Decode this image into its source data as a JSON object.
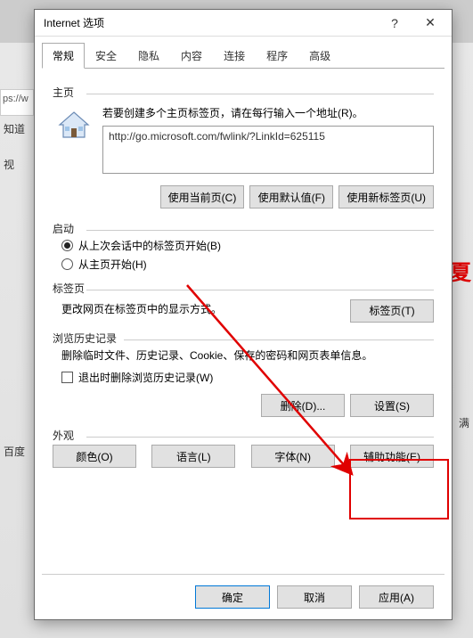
{
  "dialog": {
    "title": "Internet 选项",
    "help": "?",
    "close": "✕"
  },
  "tabs": [
    "常规",
    "安全",
    "隐私",
    "内容",
    "连接",
    "程序",
    "高级"
  ],
  "active_tab": 0,
  "homepage": {
    "group": "主页",
    "desc": "若要创建多个主页标签页，请在每行输入一个地址(R)。",
    "url": "http://go.microsoft.com/fwlink/?LinkId=625115",
    "btn_current": "使用当前页(C)",
    "btn_default": "使用默认值(F)",
    "btn_newtab": "使用新标签页(U)"
  },
  "startup": {
    "group": "启动",
    "opt_last": "从上次会话中的标签页开始(B)",
    "opt_home": "从主页开始(H)",
    "selected": 0
  },
  "tabs_section": {
    "group": "标签页",
    "desc": "更改网页在标签页中的显示方式。",
    "btn": "标签页(T)"
  },
  "history": {
    "group": "浏览历史记录",
    "desc": "删除临时文件、历史记录、Cookie、保存的密码和网页表单信息。",
    "check_label": "退出时删除浏览历史记录(W)",
    "btn_delete": "删除(D)...",
    "btn_settings": "设置(S)"
  },
  "appearance": {
    "group": "外观",
    "btn_color": "颜色(O)",
    "btn_lang": "语言(L)",
    "btn_font": "字体(N)",
    "btn_access": "辅助功能(E)"
  },
  "footer": {
    "ok": "确定",
    "cancel": "取消",
    "apply": "应用(A)"
  },
  "background": {
    "url_fragment": "ps://w",
    "label1": "知道",
    "label2": "视",
    "red1": "夏",
    "label3": "满",
    "label4": "百度"
  }
}
